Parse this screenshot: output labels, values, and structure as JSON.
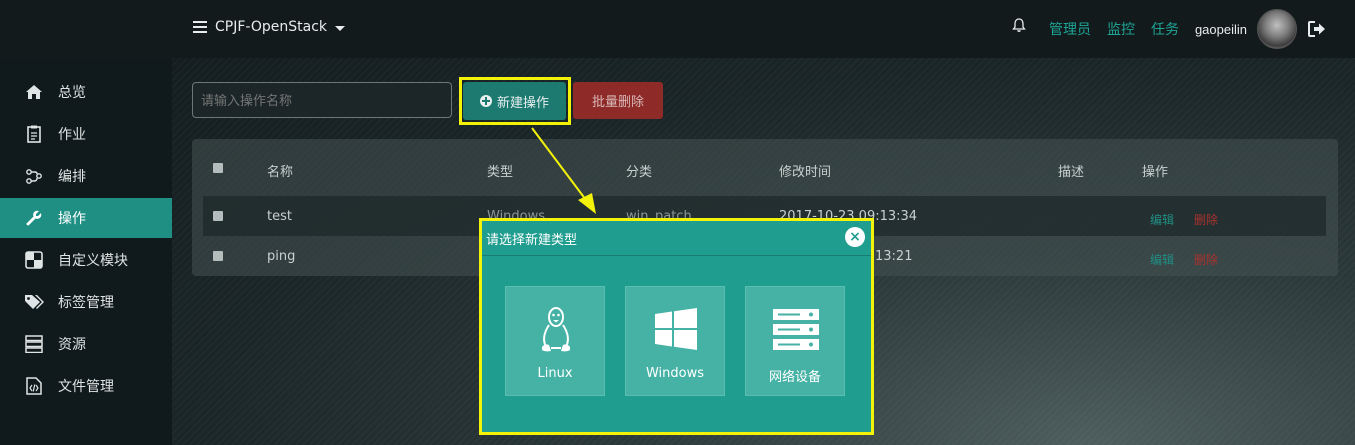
{
  "header": {
    "project_name": "CPJF-OpenStack",
    "links": [
      "管理员",
      "监控",
      "任务"
    ],
    "username": "gaopeilin"
  },
  "sidebar": {
    "items": [
      {
        "label": "总览",
        "icon": "home-icon"
      },
      {
        "label": "作业",
        "icon": "clipboard-icon"
      },
      {
        "label": "编排",
        "icon": "workflow-icon"
      },
      {
        "label": "操作",
        "icon": "wrench-icon",
        "active": true
      },
      {
        "label": "自定义模块",
        "icon": "module-icon"
      },
      {
        "label": "标签管理",
        "icon": "tags-icon"
      },
      {
        "label": "资源",
        "icon": "server-icon"
      },
      {
        "label": "文件管理",
        "icon": "file-code-icon"
      }
    ]
  },
  "toolbar": {
    "search_placeholder": "请输入操作名称",
    "new_label": "新建操作",
    "batch_delete_label": "批量删除"
  },
  "table": {
    "columns": [
      "名称",
      "类型",
      "分类",
      "修改时间",
      "描述",
      "操作"
    ],
    "rows": [
      {
        "name": "test",
        "type": "Windows",
        "category": "win_patch",
        "modified": "2017-10-23 09:13:34",
        "desc": "",
        "edit": "编辑",
        "delete": "删除"
      },
      {
        "name": "ping",
        "type": "",
        "category": "",
        "modified": "13:21",
        "desc": "",
        "edit": "编辑",
        "delete": "删除"
      }
    ]
  },
  "modal": {
    "title": "请选择新建类型",
    "options": [
      {
        "label": "Linux",
        "icon": "linux-penguin-icon"
      },
      {
        "label": "Windows",
        "icon": "windows-logo-icon"
      },
      {
        "label": "网络设备",
        "icon": "network-device-icon"
      }
    ]
  },
  "colors": {
    "accent": "#1f8f84",
    "modal": "#1f9d8f",
    "danger": "#8e2a28",
    "highlight": "#f2f20a"
  }
}
